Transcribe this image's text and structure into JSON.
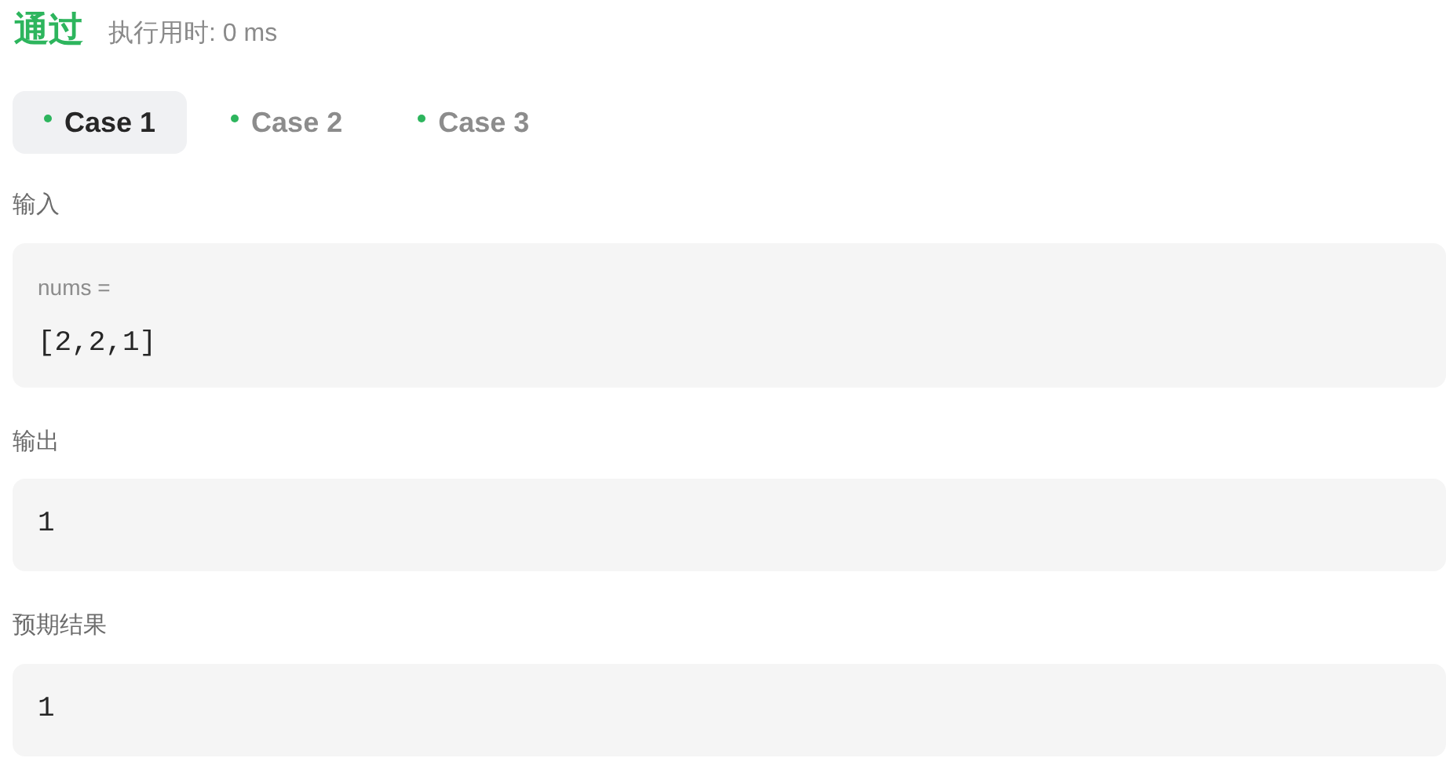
{
  "result": {
    "status": "通过",
    "runtime": "执行用时: 0 ms"
  },
  "cases": [
    {
      "label": "Case 1",
      "selected": true,
      "color": "#2db55d"
    },
    {
      "label": "Case 2",
      "selected": false,
      "color": "#2db55d"
    },
    {
      "label": "Case 3",
      "selected": false,
      "color": "#2db55d"
    }
  ],
  "input": {
    "label": "输入",
    "params": [
      {
        "name": "nums =",
        "value": "[2,2,1]"
      }
    ]
  },
  "output": {
    "label": "输出",
    "value": "1"
  },
  "expected": {
    "label": "预期结果",
    "value": "1"
  }
}
